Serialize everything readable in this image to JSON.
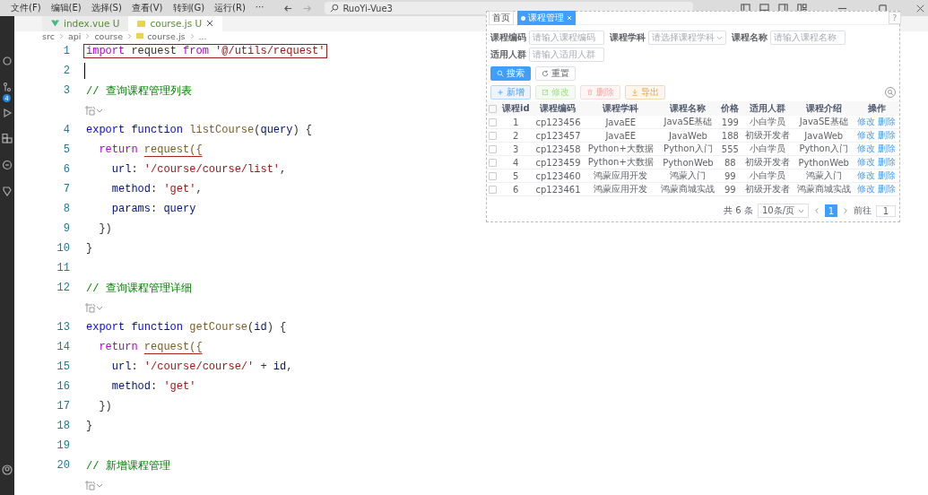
{
  "menu": [
    "文件(F)",
    "编辑(E)",
    "选择(S)",
    "查看(V)",
    "转到(G)",
    "运行(R)",
    "···"
  ],
  "title_search": "RuoYi-Vue3",
  "tabs": [
    {
      "label": "index.vue",
      "status": "U",
      "kind": "vue",
      "selected": false
    },
    {
      "label": "course.js",
      "status": "U",
      "kind": "js",
      "selected": true
    }
  ],
  "breadcrumb": [
    {
      "text": "src",
      "kind": "folder"
    },
    {
      "text": "api",
      "kind": "folder"
    },
    {
      "text": "course",
      "kind": "folder"
    },
    {
      "text": "course.js",
      "kind": "js"
    },
    {
      "text": "...",
      "kind": "folder"
    }
  ],
  "activity_badge": "4",
  "code": [
    {
      "kind": "line",
      "number": "1",
      "boxed": true,
      "tokens": [
        {
          "kind": "kw",
          "text": "import"
        },
        {
          "kind": "plain",
          "text": " request "
        },
        {
          "kind": "kw",
          "text": "from"
        },
        {
          "kind": "str",
          "text": " '@/utils/request'"
        }
      ]
    },
    {
      "kind": "line",
      "number": "2",
      "cursor": true
    },
    {
      "kind": "line",
      "number": "3",
      "tokens": [
        {
          "kind": "comment",
          "text": "// 查询课程管理列表"
        }
      ]
    },
    {
      "kind": "lens"
    },
    {
      "kind": "line",
      "number": "4",
      "tokens": [
        {
          "kind": "decl",
          "text": "export function"
        },
        {
          "kind": "fn",
          "text": " listCourse"
        },
        {
          "kind": "plain",
          "text": "("
        },
        {
          "kind": "var",
          "text": "query"
        },
        {
          "kind": "plain",
          "text": ") {"
        }
      ]
    },
    {
      "kind": "line",
      "number": "5",
      "tokens": [
        {
          "kind": "kw",
          "text": "  return "
        },
        {
          "kind": "fn",
          "text": "request({",
          "underlined": true
        }
      ]
    },
    {
      "kind": "line",
      "number": "6",
      "tokens": [
        {
          "kind": "var",
          "text": "    url"
        },
        {
          "kind": "plain",
          "text": ": "
        },
        {
          "kind": "str",
          "text": "'/course/course/list'"
        },
        {
          "kind": "plain",
          "text": ","
        }
      ]
    },
    {
      "kind": "line",
      "number": "7",
      "tokens": [
        {
          "kind": "var",
          "text": "    method"
        },
        {
          "kind": "plain",
          "text": ": "
        },
        {
          "kind": "str",
          "text": "'get'"
        },
        {
          "kind": "plain",
          "text": ","
        }
      ]
    },
    {
      "kind": "line",
      "number": "8",
      "tokens": [
        {
          "kind": "var",
          "text": "    params"
        },
        {
          "kind": "plain",
          "text": ": "
        },
        {
          "kind": "var",
          "text": "query"
        }
      ]
    },
    {
      "kind": "line",
      "number": "9",
      "tokens": [
        {
          "kind": "plain",
          "text": "  })"
        }
      ]
    },
    {
      "kind": "line",
      "number": "10",
      "tokens": [
        {
          "kind": "plain",
          "text": "}"
        }
      ]
    },
    {
      "kind": "line",
      "number": "11"
    },
    {
      "kind": "line",
      "number": "12",
      "tokens": [
        {
          "kind": "comment",
          "text": "// 查询课程管理详细"
        }
      ]
    },
    {
      "kind": "lens"
    },
    {
      "kind": "line",
      "number": "13",
      "tokens": [
        {
          "kind": "decl",
          "text": "export function"
        },
        {
          "kind": "fn",
          "text": " getCourse"
        },
        {
          "kind": "plain",
          "text": "("
        },
        {
          "kind": "var",
          "text": "id"
        },
        {
          "kind": "plain",
          "text": ") {"
        }
      ]
    },
    {
      "kind": "line",
      "number": "14",
      "tokens": [
        {
          "kind": "kw",
          "text": "  return "
        },
        {
          "kind": "fn",
          "text": "request({",
          "underlined": true
        }
      ]
    },
    {
      "kind": "line",
      "number": "15",
      "tokens": [
        {
          "kind": "var",
          "text": "    url"
        },
        {
          "kind": "plain",
          "text": ": "
        },
        {
          "kind": "str",
          "text": "'/course/course/'"
        },
        {
          "kind": "plain",
          "text": " + "
        },
        {
          "kind": "var",
          "text": "id"
        },
        {
          "kind": "plain",
          "text": ","
        }
      ]
    },
    {
      "kind": "line",
      "number": "16",
      "tokens": [
        {
          "kind": "var",
          "text": "    method"
        },
        {
          "kind": "plain",
          "text": ": "
        },
        {
          "kind": "str",
          "text": "'get'"
        }
      ]
    },
    {
      "kind": "line",
      "number": "17",
      "tokens": [
        {
          "kind": "plain",
          "text": "  })"
        }
      ]
    },
    {
      "kind": "line",
      "number": "18",
      "tokens": [
        {
          "kind": "plain",
          "text": "}"
        }
      ]
    },
    {
      "kind": "line",
      "number": "19"
    },
    {
      "kind": "line",
      "number": "20",
      "tokens": [
        {
          "kind": "comment",
          "text": "// 新增课程管理"
        }
      ]
    },
    {
      "kind": "lens"
    }
  ],
  "preview": {
    "tags": [
      {
        "label": "首页",
        "selected": false
      },
      {
        "label": "课程管理",
        "selected": true
      }
    ],
    "help": "?",
    "filters": [
      {
        "label": "课程编码",
        "placeholder": "请输入课程编码",
        "kind": "input"
      },
      {
        "label": "课程学科",
        "placeholder": "请选择课程学科",
        "kind": "select"
      },
      {
        "label": "课程名称",
        "placeholder": "请输入课程名称",
        "kind": "input"
      },
      {
        "label": "适用人群",
        "placeholder": "请输入适用人群",
        "kind": "input"
      }
    ],
    "search_buttons": [
      {
        "label": "搜索",
        "kind": "primary"
      },
      {
        "label": "重置",
        "kind": "plain"
      }
    ],
    "toolbar": [
      {
        "label": "新增",
        "kind": "add",
        "disabled": false
      },
      {
        "label": "修改",
        "kind": "edit",
        "disabled": true
      },
      {
        "label": "删除",
        "kind": "delete",
        "disabled": true
      },
      {
        "label": "导出",
        "kind": "export",
        "disabled": false
      }
    ],
    "select_all_checked": false,
    "columns": [
      "课程id",
      "课程编码",
      "课程学科",
      "课程名称",
      "价格",
      "适用人群",
      "课程介绍",
      "操作"
    ],
    "rows": [
      {
        "cells": [
          "1",
          "cp123456",
          "JavaEE",
          "JavaSE基础",
          "199",
          "小白学员",
          "JavaSE基础"
        ],
        "actions": [
          "修改",
          "删除"
        ],
        "checked": false
      },
      {
        "cells": [
          "2",
          "cp123457",
          "JavaEE",
          "JavaWeb",
          "188",
          "初级开发者",
          "JavaWeb"
        ],
        "actions": [
          "修改",
          "删除"
        ],
        "checked": false
      },
      {
        "cells": [
          "3",
          "cp123458",
          "Python+大数据",
          "Python入门",
          "555",
          "小白学员",
          "Python入门"
        ],
        "actions": [
          "修改",
          "删除"
        ],
        "checked": false
      },
      {
        "cells": [
          "4",
          "cp123459",
          "Python+大数据",
          "PythonWeb",
          "88",
          "初级开发者",
          "PythonWeb"
        ],
        "actions": [
          "修改",
          "删除"
        ],
        "checked": false
      },
      {
        "cells": [
          "5",
          "cp123460",
          "鸿蒙应用开发",
          "鸿蒙入门",
          "99",
          "小白学员",
          "鸿蒙入门"
        ],
        "actions": [
          "修改",
          "删除"
        ],
        "checked": false
      },
      {
        "cells": [
          "6",
          "cp123461",
          "鸿蒙应用开发",
          "鸿蒙商城实战",
          "99",
          "初级开发者",
          "鸿蒙商城实战"
        ],
        "actions": [
          "修改",
          "删除"
        ],
        "checked": false
      }
    ],
    "pagination": {
      "total": "共 6 条",
      "page_size": "10条/页",
      "pages": [
        {
          "label": "1",
          "selected": true
        }
      ],
      "goto": "前往",
      "goto_value": "1"
    }
  }
}
